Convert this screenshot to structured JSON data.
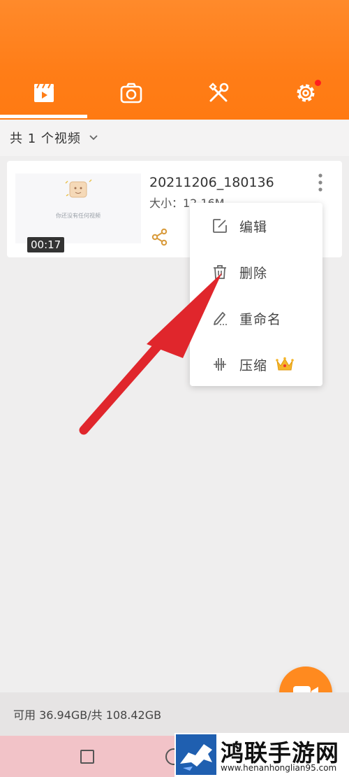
{
  "tabs": [
    {
      "icon": "video-clapper-icon",
      "active": true
    },
    {
      "icon": "camera-icon",
      "active": false
    },
    {
      "icon": "tools-icon",
      "active": false
    },
    {
      "icon": "gear-icon",
      "active": false,
      "badge": true
    }
  ],
  "colors": {
    "brand": "#ff7d17",
    "badge": "#ff1f1f",
    "accent_icon": "#d89a3a"
  },
  "list_header": {
    "count_label": "共 1 个视频"
  },
  "video": {
    "filename": "20211206_180136",
    "size_label": "大小：12.16M",
    "duration": "00:17",
    "thumbnail_text": "你还没有任何视频"
  },
  "context_menu": {
    "items": [
      {
        "label": "编辑",
        "icon": "edit-icon"
      },
      {
        "label": "删除",
        "icon": "trash-icon"
      },
      {
        "label": "重命名",
        "icon": "rename-pencil-icon"
      },
      {
        "label": "压缩",
        "icon": "compress-waveform-icon",
        "premium": true
      }
    ]
  },
  "storage": {
    "label": "可用 36.94GB/共 108.42GB"
  },
  "watermark": {
    "title": "鸿联手游网",
    "url": "www.henanhonglian95.com"
  }
}
